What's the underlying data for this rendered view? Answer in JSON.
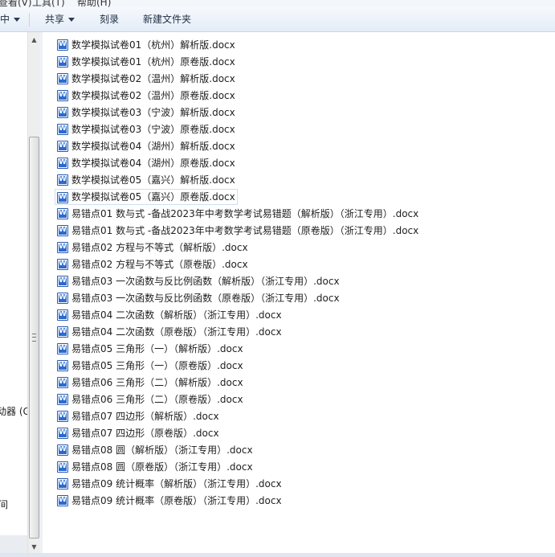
{
  "menubar": {
    "items": [
      "查看(V)",
      "工具(T)",
      "帮助(H)"
    ]
  },
  "toolbar": {
    "partial_label": "中",
    "share_label": "共享",
    "burn_label": "刻录",
    "new_folder_label": "新建文件夹"
  },
  "nav_pane": {
    "partial_item_1": "动器 (G",
    "partial_item_2": "间"
  },
  "files": [
    {
      "name": "数学模拟试卷01（杭州）解析版.docx"
    },
    {
      "name": "数学模拟试卷01（杭州）原卷版.docx"
    },
    {
      "name": "数学模拟试卷02（温州）解析版.docx"
    },
    {
      "name": "数学模拟试卷02（温州）原卷版.docx"
    },
    {
      "name": "数学模拟试卷03（宁波）解析版.docx"
    },
    {
      "name": "数学模拟试卷03（宁波）原卷版.docx"
    },
    {
      "name": "数学模拟试卷04（湖州）解析版.docx"
    },
    {
      "name": "数学模拟试卷04（湖州）原卷版.docx"
    },
    {
      "name": "数学模拟试卷05（嘉兴）解析版.docx"
    },
    {
      "name": "数学模拟试卷05（嘉兴）原卷版.docx"
    },
    {
      "name": "易错点01 数与式 -备战2023年中考数学考试易错题（解析版）（浙江专用）.docx"
    },
    {
      "name": "易错点01 数与式 -备战2023年中考数学考试易错题（原卷版）（浙江专用）.docx"
    },
    {
      "name": "易错点02 方程与不等式（解析版）.docx"
    },
    {
      "name": "易错点02 方程与不等式（原卷版）.docx"
    },
    {
      "name": "易错点03 一次函数与反比例函数（解析版）（浙江专用）.docx"
    },
    {
      "name": "易错点03 一次函数与反比例函数（原卷版）（浙江专用）.docx"
    },
    {
      "name": "易错点04 二次函数（解析版）（浙江专用）.docx"
    },
    {
      "name": "易错点04 二次函数（原卷版）（浙江专用）.docx"
    },
    {
      "name": "易错点05 三角形（一）（解析版）.docx"
    },
    {
      "name": "易错点05 三角形（一）（原卷版）.docx"
    },
    {
      "name": "易错点06 三角形（二）（解析版）.docx"
    },
    {
      "name": "易错点06 三角形（二）（原卷版）.docx"
    },
    {
      "name": "易错点07 四边形（解析版）.docx"
    },
    {
      "name": "易错点07 四边形（原卷版）.docx"
    },
    {
      "name": "易错点08 圆（解析版）（浙江专用）.docx"
    },
    {
      "name": "易错点08 圆（原卷版）（浙江专用）.docx"
    },
    {
      "name": "易错点09 统计概率（解析版）（浙江专用）.docx"
    },
    {
      "name": "易错点09 统计概率（原卷版）（浙江专用）.docx"
    }
  ],
  "icons": {
    "file": "word-document-icon",
    "scroll_up": "scroll-up-arrow-icon",
    "scroll_down": "scroll-down-arrow-icon"
  },
  "colors": {
    "toolbar_bg": "#e3ecf7",
    "word_icon": "#2b6bd0",
    "focus_border": "#cfdff2"
  }
}
